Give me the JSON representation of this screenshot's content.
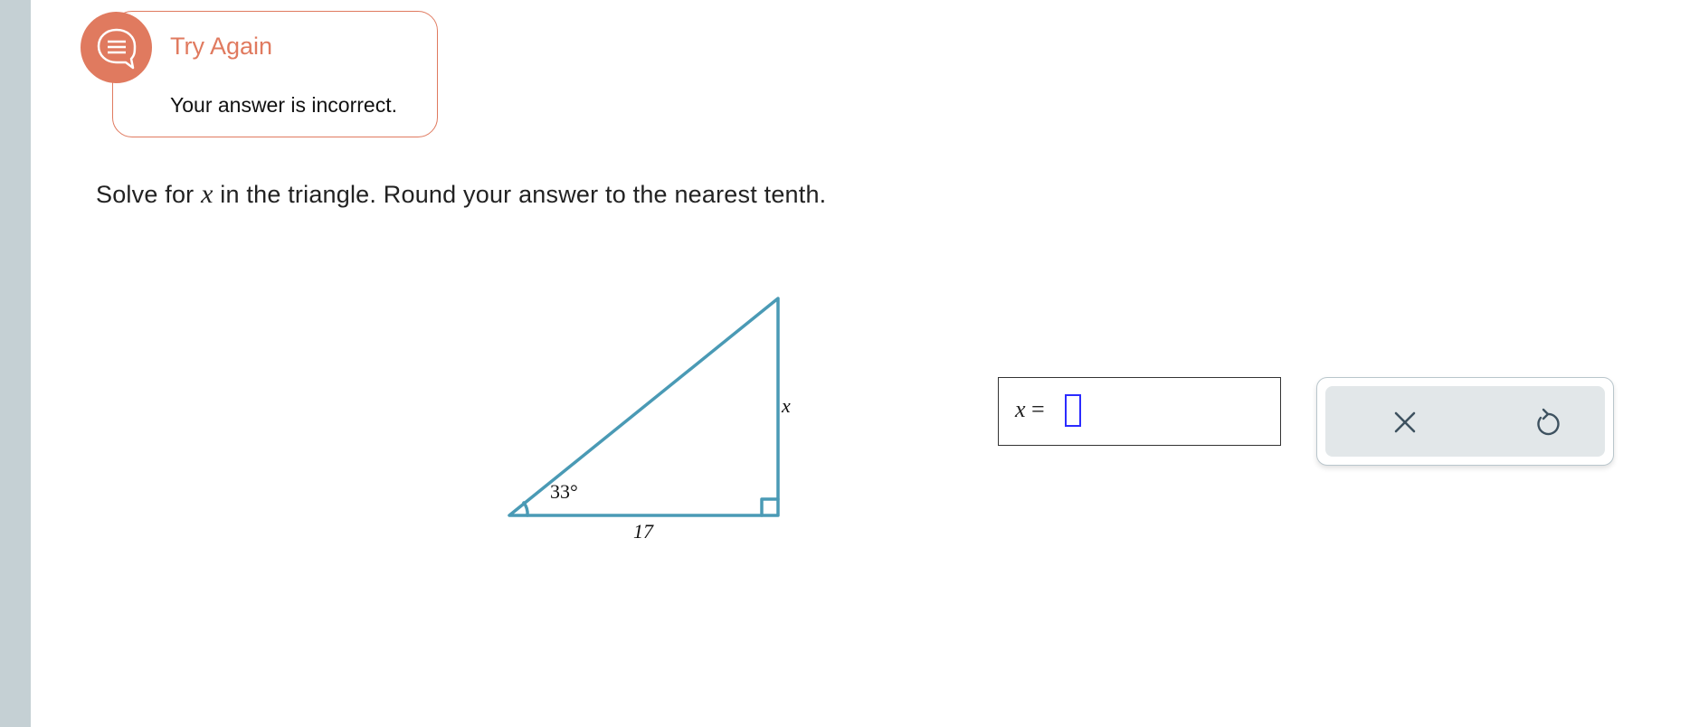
{
  "feedback": {
    "title": "Try Again",
    "message": "Your answer is incorrect.",
    "icon": "chat-bubble-icon",
    "color": "#e07a5f"
  },
  "question": {
    "prefix": "Solve for ",
    "variable": "x",
    "suffix": " in the triangle. Round your answer to the nearest tenth."
  },
  "figure": {
    "angle_label": "33°",
    "base_label": "17",
    "side_label": "x",
    "stroke_color": "#4a9ab5"
  },
  "answer": {
    "variable": "x",
    "equals": "=",
    "value": ""
  },
  "tools": {
    "clear_icon": "close-icon",
    "undo_icon": "undo-icon"
  }
}
